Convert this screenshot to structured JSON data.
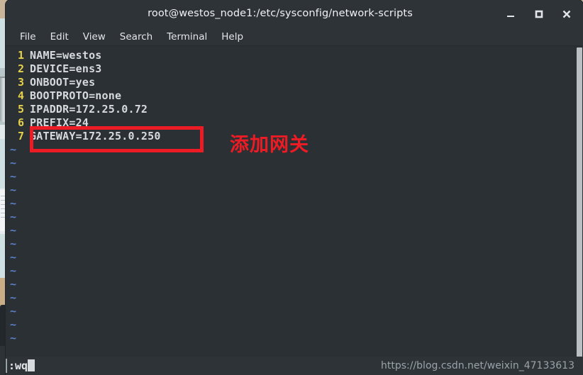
{
  "window": {
    "title": "root@westos_node1:/etc/sysconfig/network-scripts",
    "controls": {
      "minimize": "minimize-button",
      "maximize": "maximize-button",
      "close": "close-button"
    }
  },
  "menu": {
    "items": [
      {
        "label": "File"
      },
      {
        "label": "Edit"
      },
      {
        "label": "View"
      },
      {
        "label": "Search"
      },
      {
        "label": "Terminal"
      },
      {
        "label": "Help"
      }
    ]
  },
  "editor": {
    "lines": [
      {
        "number": "1",
        "text": "NAME=westos"
      },
      {
        "number": "2",
        "text": "DEVICE=ens3"
      },
      {
        "number": "3",
        "text": "ONBOOT=yes"
      },
      {
        "number": "4",
        "text": "BOOTPROTO=none"
      },
      {
        "number": "5",
        "text": "IPADDR=172.25.0.72"
      },
      {
        "number": "6",
        "text": "PREFIX=24"
      },
      {
        "number": "7",
        "text": "GATEWAY=172.25.0.250"
      }
    ],
    "empty_marker": "~",
    "empty_line_count": 15,
    "line_number_color": "#e5d14a",
    "text_color": "#d6dadc",
    "empty_marker_color": "#5b7fc7"
  },
  "annotation": {
    "text": "添加网关",
    "color": "#ed1c24",
    "highlight_target_line": "7"
  },
  "status": {
    "command": ":wq",
    "watermark": "https://blog.csdn.net/weixin_47133613"
  },
  "theme": {
    "window_chrome": "#2e3338",
    "terminal_background": "#2b3034",
    "scrollbar": "#b9bfc2"
  }
}
